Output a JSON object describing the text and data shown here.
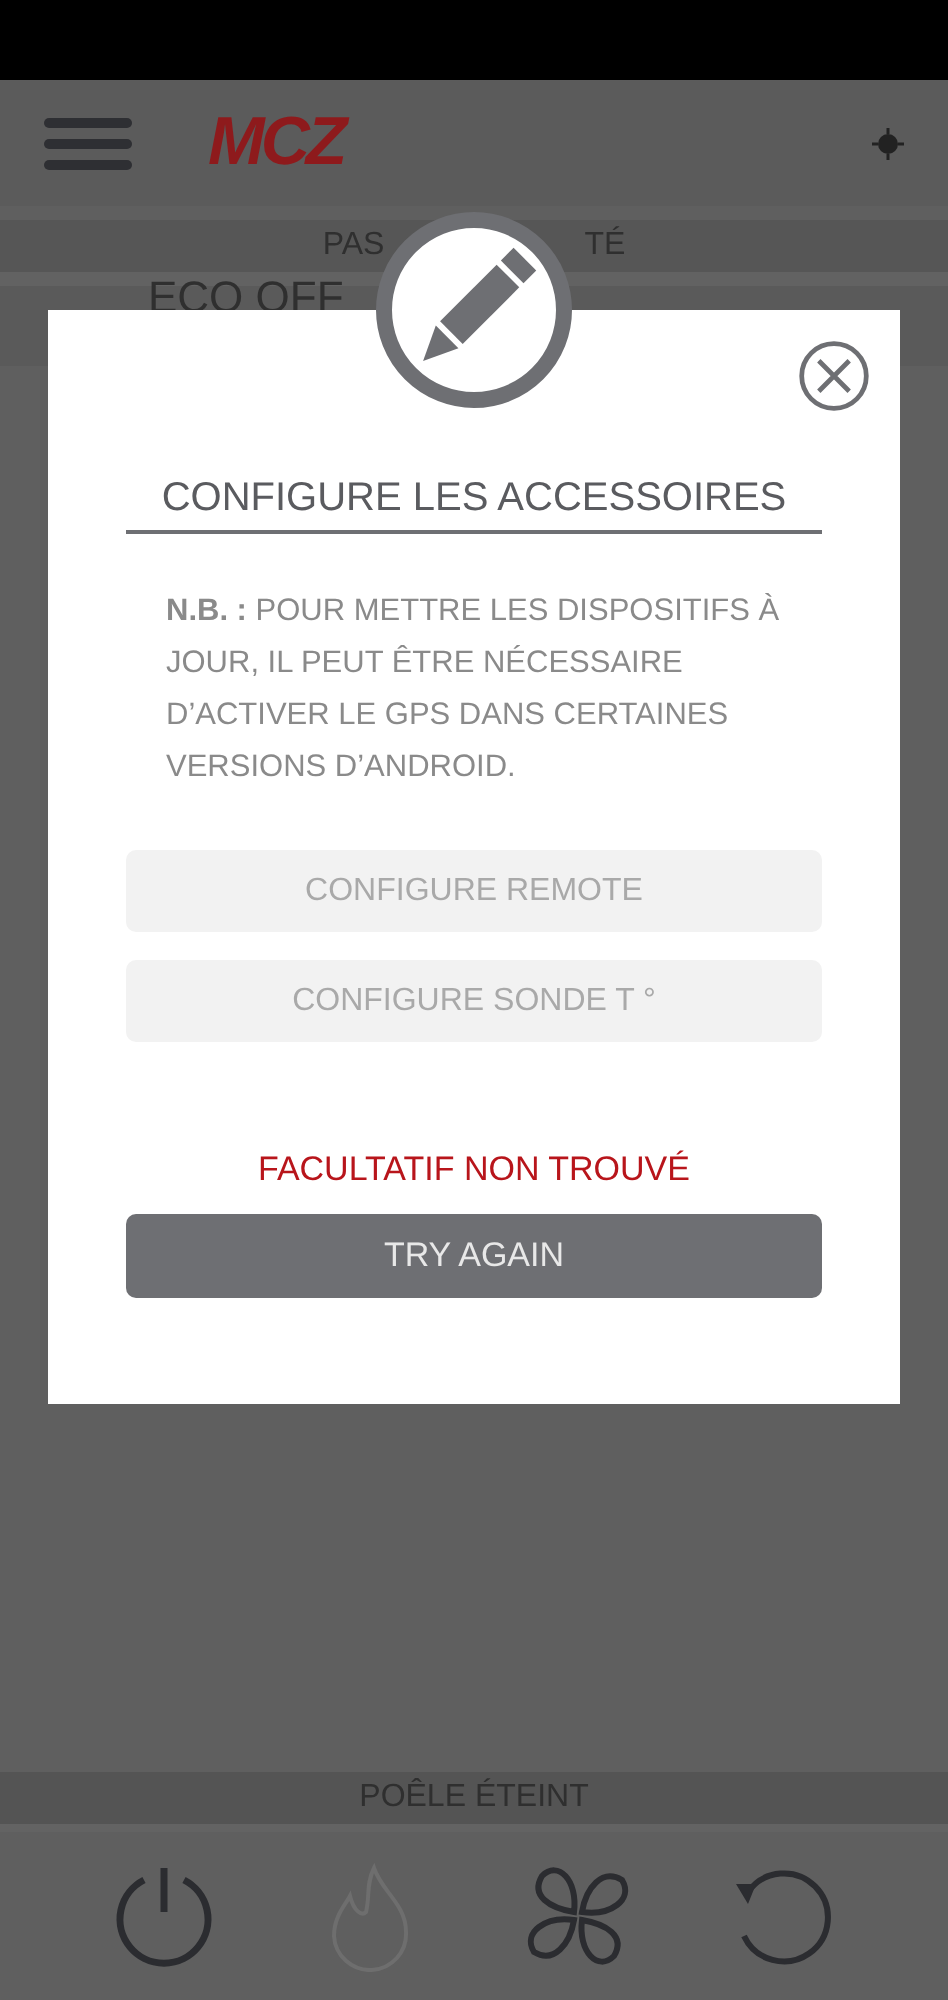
{
  "header": {
    "logo": "MCZ"
  },
  "background": {
    "mode_parts": [
      "PAS",
      "TÉ"
    ],
    "mode_row": "ECO OFF"
  },
  "dialog": {
    "title": "CONFIGURE LES ACCESSOIRES",
    "note": "**N.B. :** POUR METTRE LES DISPOSITIFS À JOUR, IL PEUT ÊTRE NÉCESSAIRE D’ACTIVER LE GPS DANS CERTAINES VERSIONS D’ANDROID.",
    "buttons": [
      {
        "label": "CONFIGURE REMOTE",
        "disabled": true
      },
      {
        "label": "CONFIGURE SONDE T °",
        "disabled": true
      }
    ],
    "error": "FACULTATIF NON TROUVÉ",
    "retry": "TRY AGAIN"
  },
  "footer": {
    "status": "POÊLE ÉTEINT",
    "controls": [
      {
        "kind": "power",
        "disabled": false
      },
      {
        "kind": "flame",
        "disabled": true
      },
      {
        "kind": "fan",
        "disabled": false
      },
      {
        "kind": "reset",
        "disabled": false
      }
    ]
  }
}
